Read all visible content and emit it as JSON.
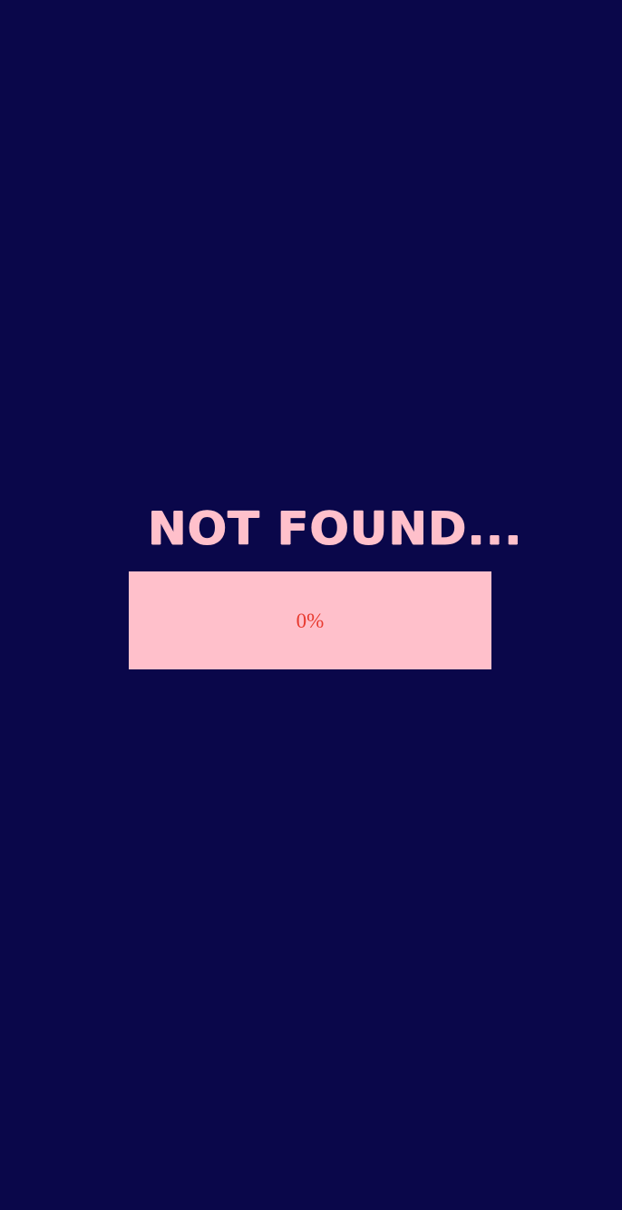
{
  "screen": {
    "title": "NOT FOUND...",
    "progress": {
      "label": "0%",
      "value": 0
    },
    "colors": {
      "background": "#0a074a",
      "title": "#ffc0cb",
      "progress_bar": "#ffc0cb",
      "progress_text": "#e83a2f"
    }
  }
}
